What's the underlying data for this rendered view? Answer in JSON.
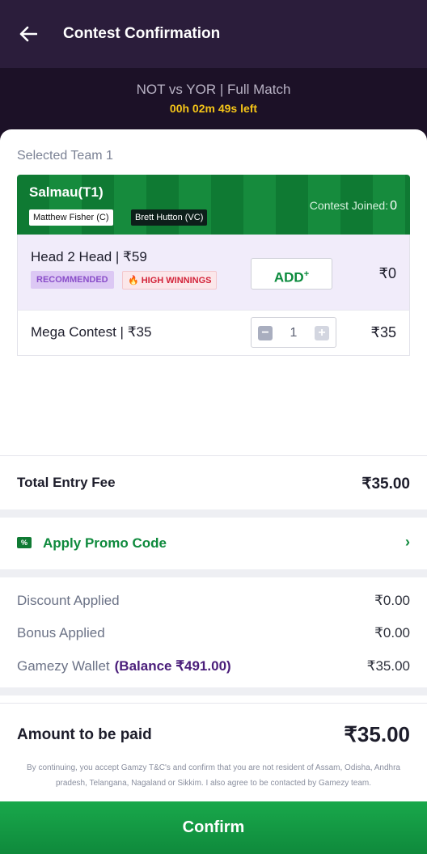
{
  "header": {
    "title": "Contest Confirmation",
    "back_icon": "arrow-left-icon"
  },
  "match": {
    "name": "NOT vs YOR | Full Match",
    "time_left": "00h 02m 49s  left"
  },
  "team": {
    "section_label": "Selected Team 1",
    "name": "Salmau(T1)",
    "captain": "Matthew Fisher (C)",
    "vice_captain": "Brett Hutton (VC)",
    "contest_joined_label": "Contest Joined:",
    "contest_joined_count": "0"
  },
  "contests": [
    {
      "name": "Head 2 Head | ₹59",
      "badges": [
        "RECOMMENDED",
        "HIGH WINNINGS"
      ],
      "action_label": "ADD",
      "action_sup": "+",
      "amount": "₹0"
    },
    {
      "name": "Mega Contest | ₹35",
      "quantity": "1",
      "amount": "₹35"
    }
  ],
  "summary": {
    "total_label": "Total Entry Fee",
    "total_value": "₹35.00",
    "promo_label": "Apply Promo Code",
    "promo_icon_text": "%",
    "discount_label": "Discount Applied",
    "discount_value": "₹0.00",
    "bonus_label": "Bonus Applied",
    "bonus_value": "₹0.00",
    "wallet_label": "Gamezy Wallet",
    "wallet_balance": "(Balance ₹491.00)",
    "wallet_value": "₹35.00",
    "pay_label": "Amount to be paid",
    "pay_value": "₹35.00"
  },
  "disclaimer": "By continuing, you accept Gamzy T&C's and confirm that you are not resident of Assam, Odisha, Andhra pradesh, Telangana, Nagaland or Sikkim. I also agree to be contacted by Gamezy team.",
  "confirm_label": "Confirm",
  "colors": {
    "header_bg": "#2b1d3b",
    "accent_green": "#0f8a3c",
    "timer": "#f5c518",
    "wallet_purple": "#4a1d7a"
  }
}
